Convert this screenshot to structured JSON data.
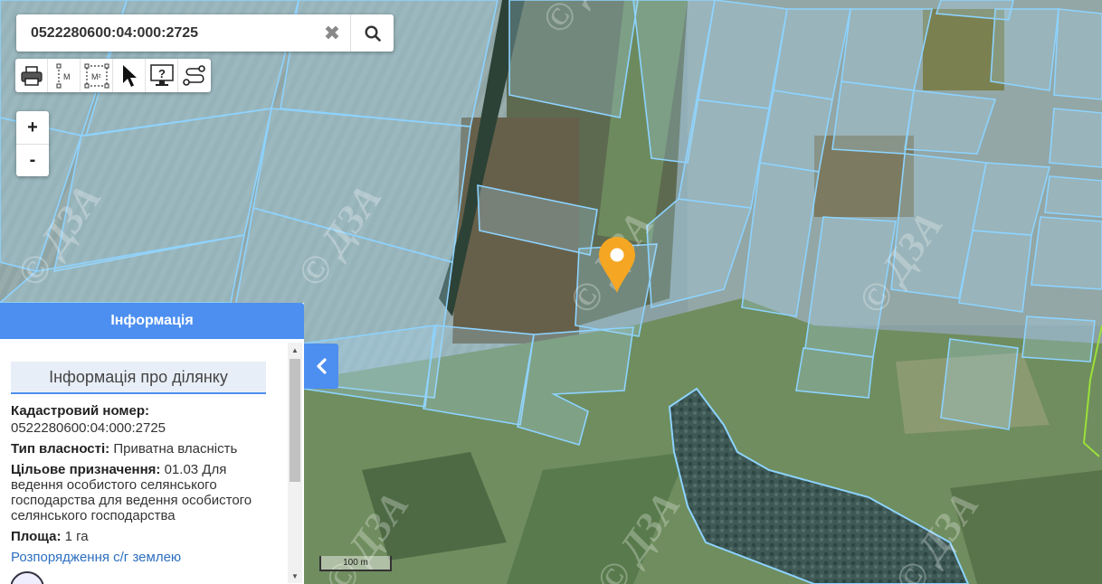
{
  "search": {
    "value": "0522280600:04:000:2725",
    "clear_icon": "close-icon",
    "search_icon": "search-icon"
  },
  "toolbar": {
    "tools": [
      {
        "name": "print-icon"
      },
      {
        "name": "measure-distance-icon",
        "glyph": "M"
      },
      {
        "name": "measure-area-icon",
        "glyph": "M²"
      },
      {
        "name": "pointer-icon"
      },
      {
        "name": "info-monitor-icon",
        "glyph": "?"
      },
      {
        "name": "route-icon"
      }
    ]
  },
  "zoom": {
    "in_label": "+",
    "out_label": "-"
  },
  "map": {
    "watermark": "© ДЗА",
    "scale_label": "100 m",
    "marker_color": "#f5a623",
    "parcel_stroke": "#7fd0ff",
    "highlight_stroke": "#9be03a"
  },
  "info_panel": {
    "header": "Інформація",
    "section_title": "Інформація про ділянку",
    "cadastral_label": "Кадастровий номер:",
    "cadastral_value": "0522280600:04:000:2725",
    "ownership_label": "Тип власності:",
    "ownership_value": "Приватна власність",
    "purpose_label": "Цільове призначення:",
    "purpose_value": "01.03 Для ведення особистого селянського господарства для ведення особистого селянського господарства",
    "area_label": "Площа:",
    "area_value": "1 га",
    "link_label": "Розпорядження с/г землею",
    "collapse_icon": "chevron-left-icon",
    "accent": "#4d8ff0"
  }
}
